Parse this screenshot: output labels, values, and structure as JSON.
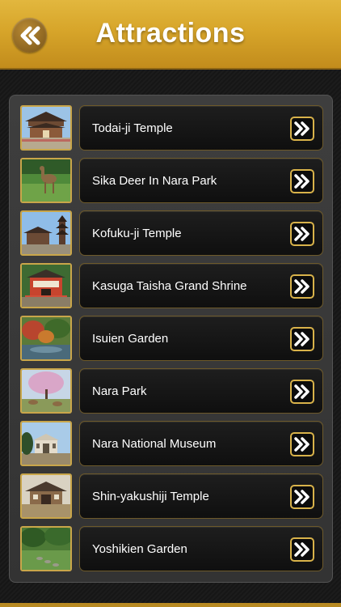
{
  "header": {
    "title": "Attractions",
    "back_icon": "double-chevron-left-icon"
  },
  "colors": {
    "header_gold": "#d7a52a",
    "accent_gold": "#d8b24a",
    "panel": "#3a3a3a",
    "button_bg": "#141414",
    "text": "#ffffff"
  },
  "list": {
    "items": [
      {
        "label": "Todai-ji Temple",
        "icon": "double-chevron-right-icon"
      },
      {
        "label": "Sika Deer In Nara Park",
        "icon": "double-chevron-right-icon"
      },
      {
        "label": "Kofuku-ji Temple",
        "icon": "double-chevron-right-icon"
      },
      {
        "label": "Kasuga Taisha Grand Shrine",
        "icon": "double-chevron-right-icon"
      },
      {
        "label": "Isuien Garden",
        "icon": "double-chevron-right-icon"
      },
      {
        "label": "Nara Park",
        "icon": "double-chevron-right-icon"
      },
      {
        "label": "Nara National Museum",
        "icon": "double-chevron-right-icon"
      },
      {
        "label": "Shin-yakushiji Temple",
        "icon": "double-chevron-right-icon"
      },
      {
        "label": "Yoshikien Garden",
        "icon": "double-chevron-right-icon"
      }
    ]
  }
}
